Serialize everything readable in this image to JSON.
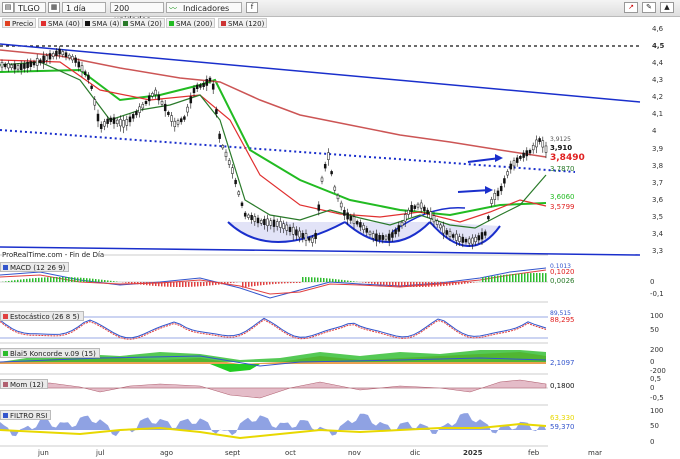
{
  "toolbar": {
    "symbol": "TLGO",
    "interval": "1 día",
    "units": "200 unidades",
    "indicators": "Indicadores"
  },
  "legend": [
    {
      "label": "Precio",
      "color": "#e04020"
    },
    {
      "label": "SMA (40)",
      "color": "#e03030"
    },
    {
      "label": "SMA (4)",
      "color": "#111111"
    },
    {
      "label": "SMA (20)",
      "color": "#2a7a2a"
    },
    {
      "label": "SMA (200)",
      "color": "#22bb22"
    },
    {
      "label": "SMA (120)",
      "color": "#cc3333"
    }
  ],
  "source": "ProRealTime.com - Fin de Día",
  "price_axis": [
    "4,6",
    "4,5",
    "4,4",
    "4,3",
    "4,2",
    "4,1",
    "4",
    "3,9",
    "3,8",
    "3,7",
    "3,6",
    "3,5",
    "3,4",
    "3,3"
  ],
  "price_values": [
    {
      "text": "3,9125",
      "color": "#555555"
    },
    {
      "text": "3,910",
      "color": "#111111"
    },
    {
      "text": "3,8490",
      "color": "#e02020"
    },
    {
      "text": "3,7870",
      "color": "#2a7a2a"
    },
    {
      "text": "3,6060",
      "color": "#22bb22"
    },
    {
      "text": "3,5799",
      "color": "#e02020"
    }
  ],
  "x_axis": [
    "jun",
    "jul",
    "ago",
    "sept",
    "oct",
    "nov",
    "dic",
    "2025",
    "feb",
    "mar"
  ],
  "panels": [
    {
      "label": "MACD (12 26 9)",
      "axis": [
        "",
        "0",
        "-0,1"
      ],
      "values": [
        "0,1013",
        "0,1020",
        "0,0026"
      ]
    },
    {
      "label": "Estocástico (26 8 5)",
      "axis": [
        "100",
        "50"
      ],
      "values": [
        "89,515",
        "88,295"
      ]
    },
    {
      "label": "Blai5 Koncorde v.09 (15)",
      "axis": [
        "200",
        "0",
        "-200"
      ],
      "values": [
        "2,1097"
      ]
    },
    {
      "label": "Mom (12)",
      "axis": [
        "0,5",
        "0",
        "-0,5"
      ],
      "values": [
        "0,1800"
      ]
    },
    {
      "label": "FILTRO RSI",
      "axis": [
        "100",
        "50",
        "0"
      ],
      "values": [
        "63,330",
        "59,370"
      ]
    }
  ],
  "colors": {
    "channel": "#1a2fcc",
    "sma40": "#e03030",
    "sma20": "#2a7a2a",
    "sma200": "#22bb22",
    "sma120": "#cc5555",
    "candle": "#111111"
  }
}
